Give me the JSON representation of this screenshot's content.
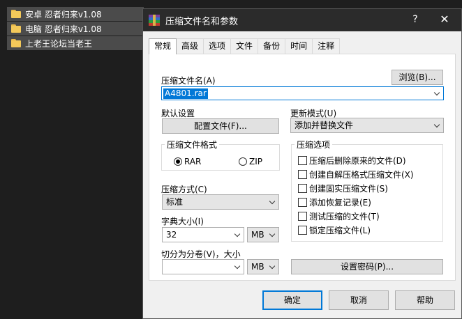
{
  "files": [
    {
      "name": "安卓 忍者归来v1.08"
    },
    {
      "name": "电脑 忍者归来v1.08"
    },
    {
      "name": "上老王论坛当老王"
    }
  ],
  "dialog": {
    "title": "压缩文件名和参数",
    "help": "?",
    "close": "✕",
    "tabs": [
      "常规",
      "高级",
      "选项",
      "文件",
      "备份",
      "时间",
      "注释"
    ],
    "active_tab": "常规",
    "archive_name_label": "压缩文件名(A)",
    "browse": "浏览(B)...",
    "archive_name_value": "A4801.rar",
    "default_settings_label": "默认设置",
    "profiles_button": "配置文件(F)...",
    "update_mode_label": "更新模式(U)",
    "update_mode_value": "添加并替换文件",
    "format_group": "压缩文件格式",
    "format_rar": "RAR",
    "format_zip": "ZIP",
    "selected_format": "RAR",
    "method_label": "压缩方式(C)",
    "method_value": "标准",
    "dict_label": "字典大小(I)",
    "dict_value": "32",
    "dict_unit": "MB",
    "split_label": "切分为分卷(V)，大小",
    "split_value": "",
    "split_unit": "MB",
    "options_group": "压缩选项",
    "options": [
      "压缩后删除原来的文件(D)",
      "创建自解压格式压缩文件(X)",
      "创建固实压缩文件(S)",
      "添加恢复记录(E)",
      "测试压缩的文件(T)",
      "锁定压缩文件(L)"
    ],
    "password_button": "设置密码(P)...",
    "ok": "确定",
    "cancel": "取消",
    "help_button": "帮助"
  }
}
